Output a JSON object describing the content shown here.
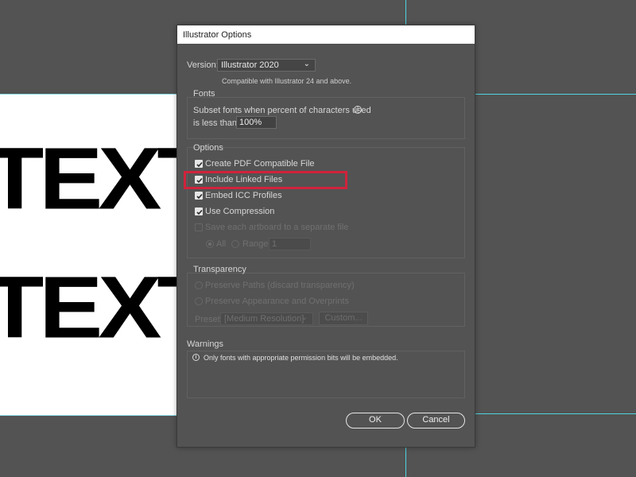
{
  "canvas": {
    "art_text_1": "TEXT",
    "art_text_2": "TEXT",
    "guide_color": "#4fd3e0"
  },
  "dialog": {
    "title": "Illustrator Options",
    "version_label": "Version:",
    "version_value": "Illustrator 2020",
    "version_compat": "Compatible with Illustrator 24 and above.",
    "fonts": {
      "title": "Fonts",
      "subset_text": "Subset fonts when percent of characters used",
      "less_than_label": "is less than:",
      "percent_value": "100%"
    },
    "options": {
      "title": "Options",
      "create_pdf": {
        "label": "Create PDF Compatible File",
        "checked": true
      },
      "include_linked": {
        "label": "Include Linked Files",
        "checked": true
      },
      "embed_icc": {
        "label": "Embed ICC Profiles",
        "checked": true
      },
      "use_compression": {
        "label": "Use Compression",
        "checked": true
      },
      "save_artboards": {
        "label": "Save each artboard to a separate file",
        "checked": false
      },
      "all_label": "All",
      "range_label": "Range:",
      "range_value": "1"
    },
    "transparency": {
      "title": "Transparency",
      "preserve_paths": "Preserve Paths (discard transparency)",
      "preserve_appearance": "Preserve Appearance and Overprints",
      "preset_label": "Preset:",
      "preset_value": "[Medium Resolution]",
      "custom_label": "Custom..."
    },
    "warnings": {
      "title": "Warnings",
      "message": "Only fonts with appropriate permission bits will be embedded."
    },
    "ok_label": "OK",
    "cancel_label": "Cancel",
    "highlight_color": "#d0233c"
  }
}
